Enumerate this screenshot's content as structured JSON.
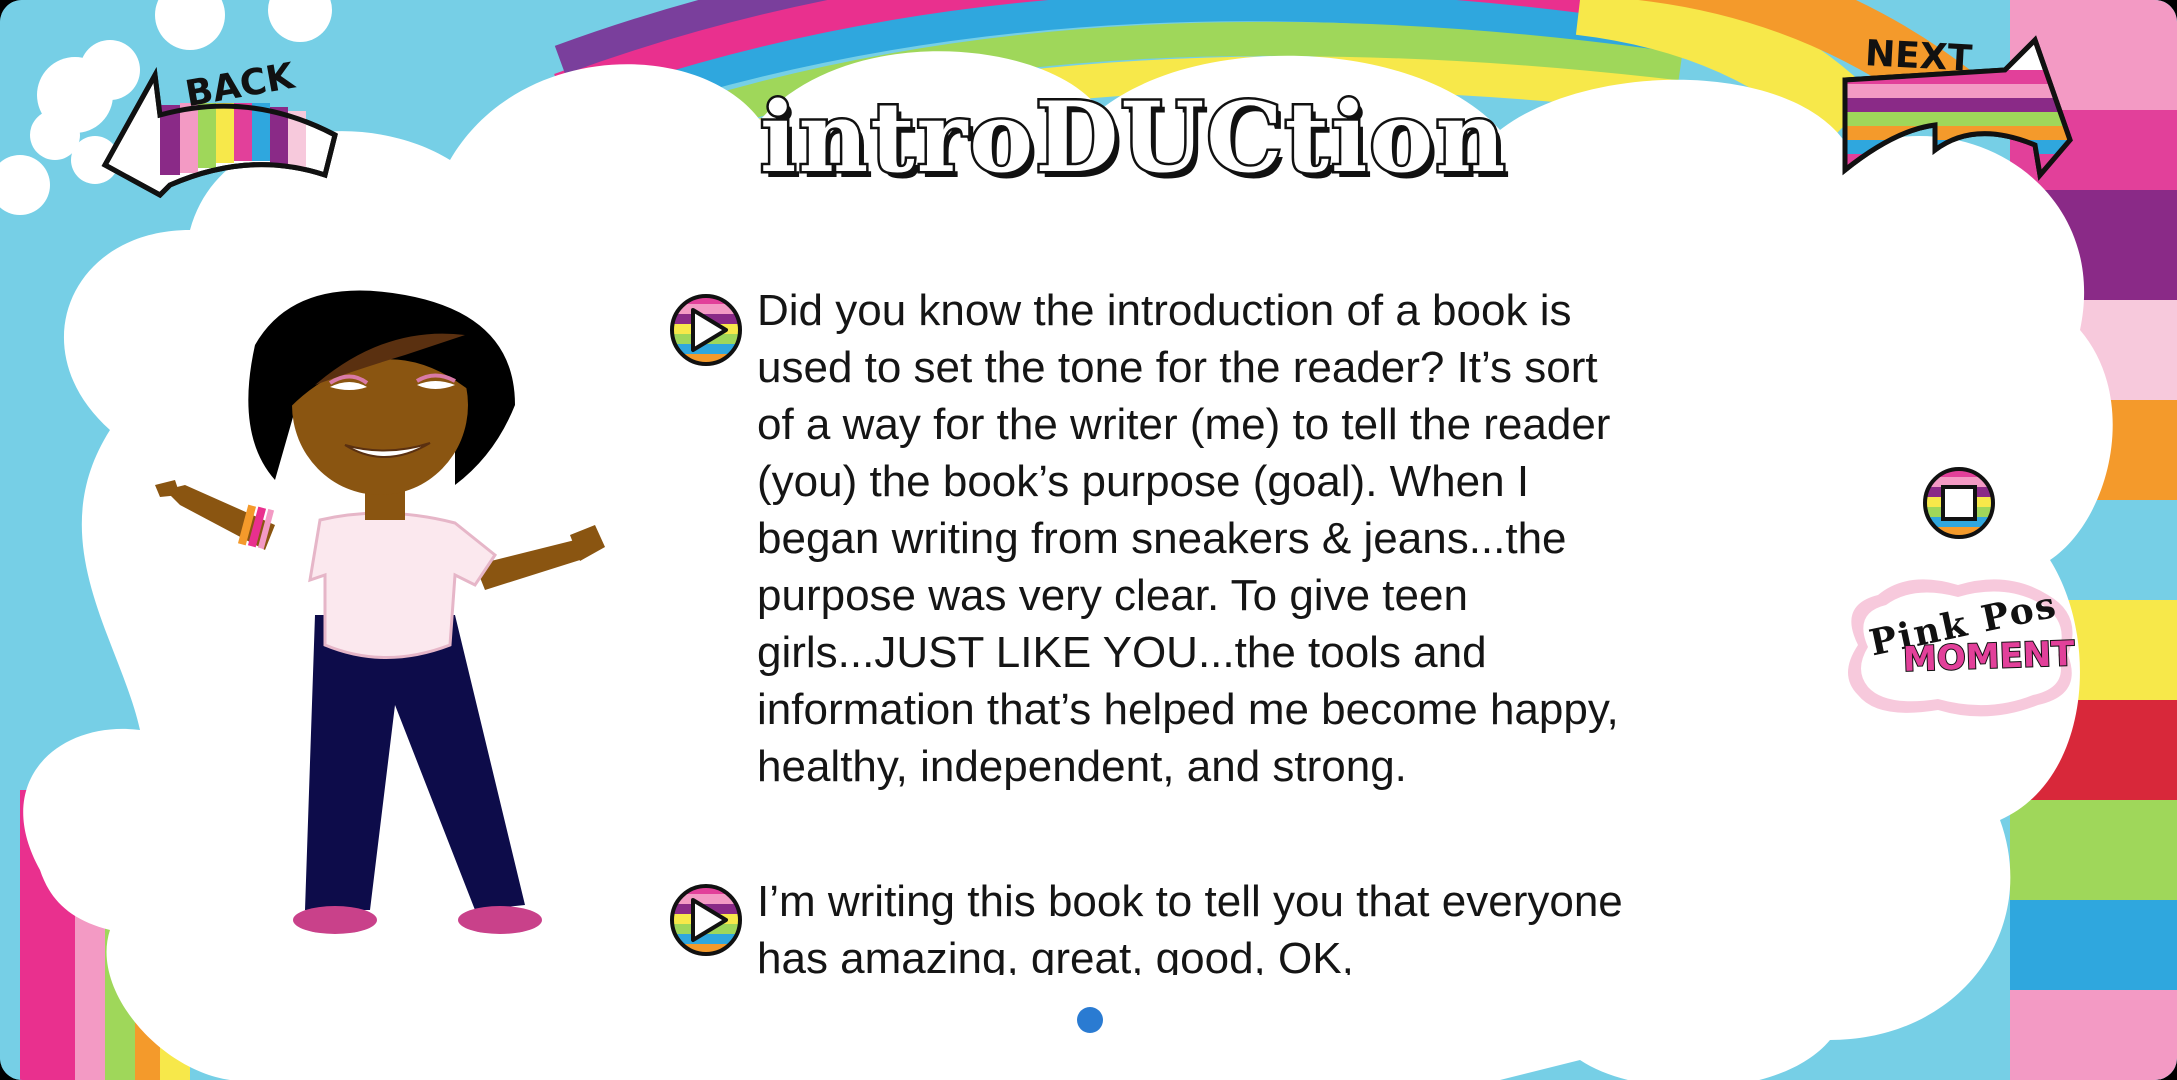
{
  "page": {
    "title": "introDUCtion",
    "colors": {
      "sky": "#76cfe6",
      "cloud": "#ffffff",
      "text": "#151515",
      "page_indicator": "#2a7bd2",
      "pink": "#e2409a"
    }
  },
  "nav": {
    "back_label": "BACK",
    "next_label": "NEXT"
  },
  "content": {
    "paragraph_1": "Did you know the introduction of a book is used to set the tone for the reader? It’s sort of a way for the writer (me) to tell the reader (you) the book’s purpose (goal). When I began writing from sneakers & jeans...the purpose was very clear. To give teen girls...JUST LIKE YOU...the tools and information that’s helped me become happy, healthy, independent, and strong.",
    "paragraph_2": "I’m writing this book to tell you that everyone has amazing, great, good, OK,"
  },
  "side": {
    "pink_pos_line1": "Pink Pos",
    "pink_pos_line2": "MOMENT"
  },
  "icons": {
    "play": "play-icon",
    "stop": "stop-icon",
    "back": "back-arrow-icon",
    "next": "next-arrow-icon"
  }
}
